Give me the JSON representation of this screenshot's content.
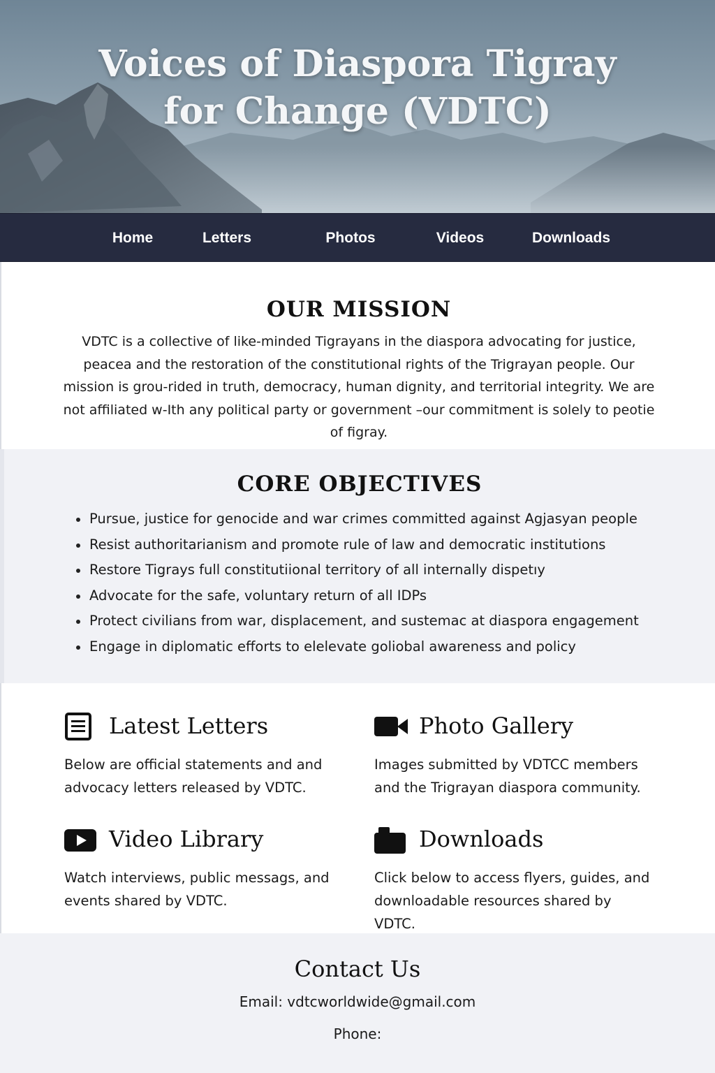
{
  "hero": {
    "title": "Voices of Diaspora Tigray for Change (VDTC)"
  },
  "nav": {
    "items": [
      {
        "label": "Home"
      },
      {
        "label": "Letters"
      },
      {
        "label": "Photos"
      },
      {
        "label": "Videos"
      },
      {
        "label": "Downloads"
      }
    ]
  },
  "mission": {
    "heading": "OUR MISSION",
    "body": "VDTC is a collective of like-minded Tigrayans in the diaspora advocating for justice, peacea and the restoration of the constitutional rights of the Trigrayan people. Our mission is grou-rided in truth, democracy, human dignity, and territorial integrity. We are not affiliated w-Ith any political party or government –our commitment is solely to peotie of figray."
  },
  "objectives": {
    "heading": "CORE OBJECTIVES",
    "items": [
      "Pursue, justice for genocide and war crimes committed against Agjasyan people",
      "Resist authoritarianism and promote rule of law and democratic institutions",
      "Restore Tigrays full constitutiional territory of all internally dispetıy",
      "Advocate for the safe, voluntary return of all IDPs",
      "Protect civilians from war, displacement, and sustemac at diaspora engagement",
      "Engage in diplomatic efforts to elelevate goliobal awareness and policy"
    ]
  },
  "cards": [
    {
      "icon": "document-icon",
      "title": "Latest Letters",
      "desc": "Below are official statements and and advocacy letters released by VDTC."
    },
    {
      "icon": "video-camera-icon",
      "title": "Photo Gallery",
      "desc": "Images submitted by VDTCC members and the Trigrayan diaspora community."
    },
    {
      "icon": "play-button-icon",
      "title": "Video Library",
      "desc": "Watch interviews, public messags, and events shared by VDTC."
    },
    {
      "icon": "camera-icon",
      "title": "Downloads",
      "desc": "Click below to access flyers, guides, and downloadable resources shared by VDTC."
    }
  ],
  "contact": {
    "heading": "Contact Us",
    "email_line": "Email: vdtcworldwide@gmail.com",
    "phone_line": "Phone:"
  },
  "colors": {
    "nav_background": "#262b40",
    "section_alt_background": "#f1f2f6",
    "hero_text": "#f4f6f8"
  }
}
